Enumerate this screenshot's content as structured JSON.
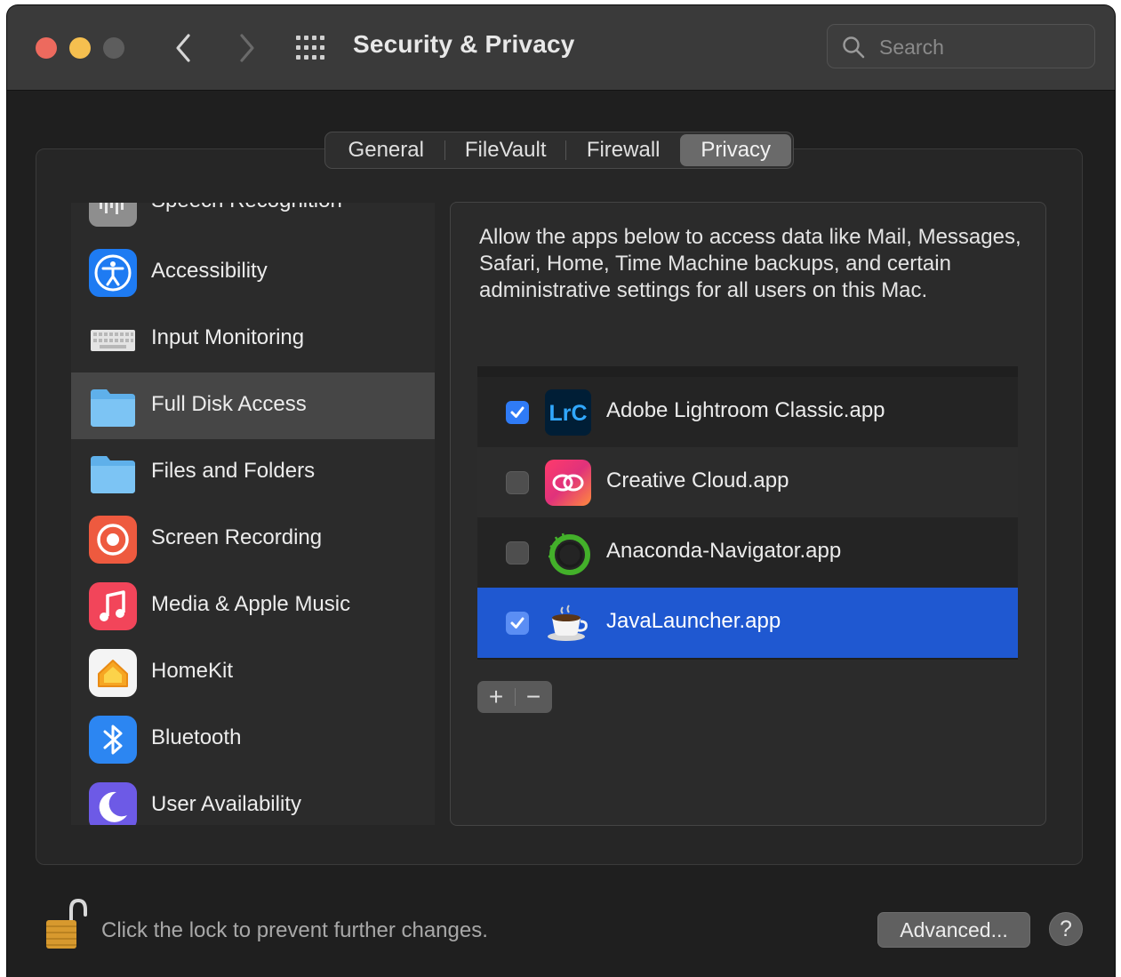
{
  "window": {
    "title": "Security & Privacy",
    "search_placeholder": "Search"
  },
  "tabs": [
    {
      "label": "General"
    },
    {
      "label": "FileVault"
    },
    {
      "label": "Firewall"
    },
    {
      "label": "Privacy",
      "selected": true
    }
  ],
  "sidebar": {
    "items": [
      {
        "label": "Speech Recognition",
        "icon": "waveform-icon"
      },
      {
        "label": "Accessibility",
        "icon": "accessibility-icon"
      },
      {
        "label": "Input Monitoring",
        "icon": "keyboard-icon"
      },
      {
        "label": "Full Disk Access",
        "icon": "folder-icon",
        "selected": true
      },
      {
        "label": "Files and Folders",
        "icon": "folder-icon"
      },
      {
        "label": "Screen Recording",
        "icon": "record-icon"
      },
      {
        "label": "Media & Apple Music",
        "icon": "music-note-icon"
      },
      {
        "label": "HomeKit",
        "icon": "home-icon"
      },
      {
        "label": "Bluetooth",
        "icon": "bluetooth-icon"
      },
      {
        "label": "User Availability",
        "icon": "moon-icon"
      }
    ]
  },
  "content": {
    "description": "Allow the apps below to access data like Mail, Messages, Safari, Home, Time Machine backups, and certain administrative settings for all users on this Mac.",
    "apps": [
      {
        "name": "Adobe Lightroom Classic.app",
        "checked": true,
        "icon": "lightroom-classic-icon",
        "icon_text": "LrC"
      },
      {
        "name": "Creative Cloud.app",
        "checked": false,
        "icon": "creative-cloud-icon"
      },
      {
        "name": "Anaconda-Navigator.app",
        "checked": false,
        "icon": "anaconda-icon"
      },
      {
        "name": "JavaLauncher.app",
        "checked": true,
        "icon": "coffee-cup-icon",
        "selected": true
      }
    ],
    "add_label": "+",
    "remove_label": "−"
  },
  "footer": {
    "lock_text": "Click the lock to prevent further changes.",
    "advanced_label": "Advanced...",
    "help_label": "?"
  },
  "colors": {
    "selection_blue": "#1f58d1",
    "checkbox_blue": "#2f7bf6",
    "traffic_red": "#ed6a5e",
    "traffic_yellow": "#f5bf4f"
  }
}
